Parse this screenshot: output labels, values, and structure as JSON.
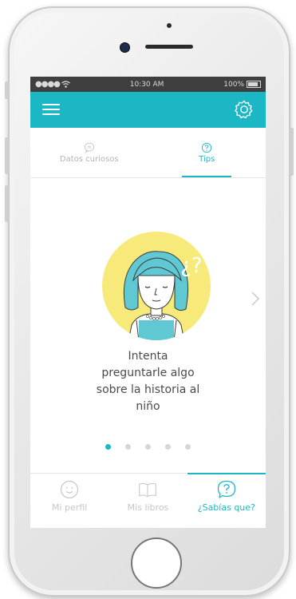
{
  "status_bar": {
    "time": "10:30 AM",
    "battery": "100%"
  },
  "tabs": [
    {
      "label": "Datos curiosos",
      "icon": "chat-bubble-icon",
      "active": false
    },
    {
      "label": "Tips",
      "icon": "question-circle-icon",
      "active": true
    }
  ],
  "tip": {
    "text": "Intenta preguntarle algo sobre la historia al niño",
    "illustration_text": "¿?"
  },
  "pager": {
    "total": 5,
    "current": 1
  },
  "bottom_nav": [
    {
      "label": "Mi perfil",
      "icon": "smiley-icon",
      "active": false
    },
    {
      "label": "Mis libros",
      "icon": "book-icon",
      "active": false
    },
    {
      "label": "¿Sabías que?",
      "icon": "question-bubble-icon",
      "active": true
    }
  ],
  "colors": {
    "accent": "#1bb7c4",
    "statusbar": "#3f3f3f",
    "illustration_bg": "#f7ea7a",
    "hair": "#5fc8d2"
  }
}
